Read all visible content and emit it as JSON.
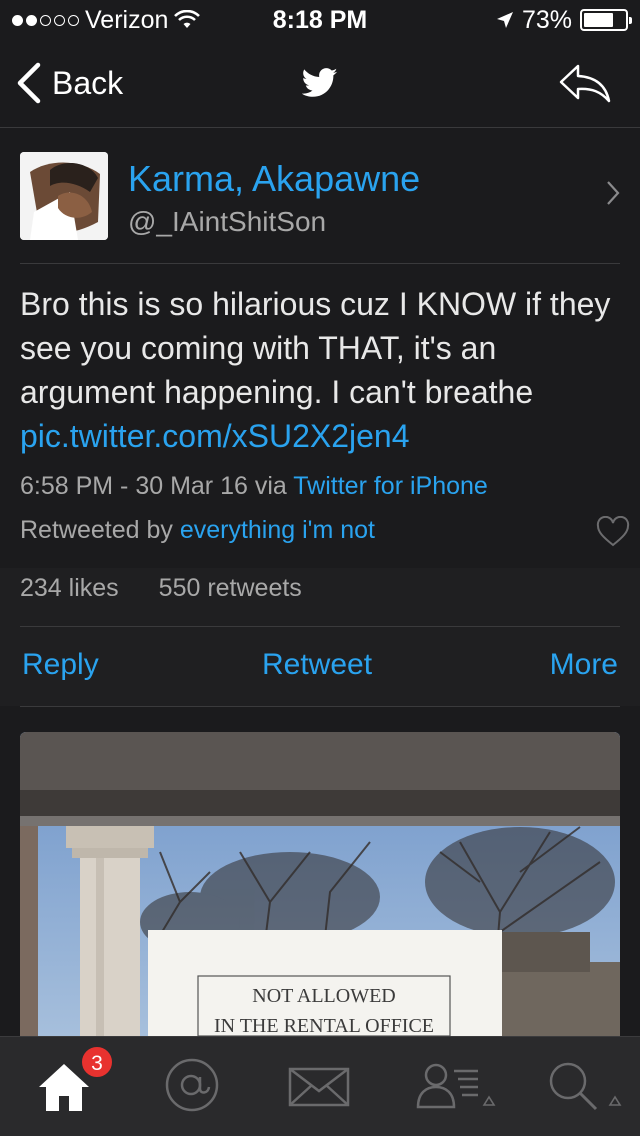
{
  "status_bar": {
    "carrier": "Verizon",
    "time": "8:18 PM",
    "battery": "73%",
    "battery_level": 0.73,
    "signal_bars_filled": 2,
    "signal_bars_total": 5
  },
  "nav": {
    "back_label": "Back",
    "center_icon": "twitter-bird-icon",
    "right_icon": "reply-arrow-icon"
  },
  "profile": {
    "name": "Karma, Akapawne",
    "handle": "@_IAintShitSon"
  },
  "tweet": {
    "text": "Bro this is so hilarious cuz I KNOW if they see you coming with THAT, it's an argument happening. I can't breathe ",
    "link": "pic.twitter.com/xSU2X2jen4",
    "timestamp": "6:58 PM - 30 Mar 16 via ",
    "client": "Twitter for iPhone",
    "retweeted_by_label": "Retweeted by ",
    "retweeted_by": "everything i'm not",
    "likes": "234 likes",
    "retweets": "550 retweets"
  },
  "actions": {
    "reply": "Reply",
    "retweet": "Retweet",
    "more": "More"
  },
  "photo": {
    "sign_line1": "NOT ALLOWED",
    "sign_line2": "IN THE RENTAL OFFICE"
  },
  "tabbar": {
    "badge": "3",
    "tabs": [
      "home-icon",
      "mentions-icon",
      "messages-icon",
      "profile-lists-icon",
      "search-icon"
    ]
  },
  "colors": {
    "accent": "#2aa3ef",
    "background": "#1b1b1d",
    "badge": "#e8322f"
  }
}
